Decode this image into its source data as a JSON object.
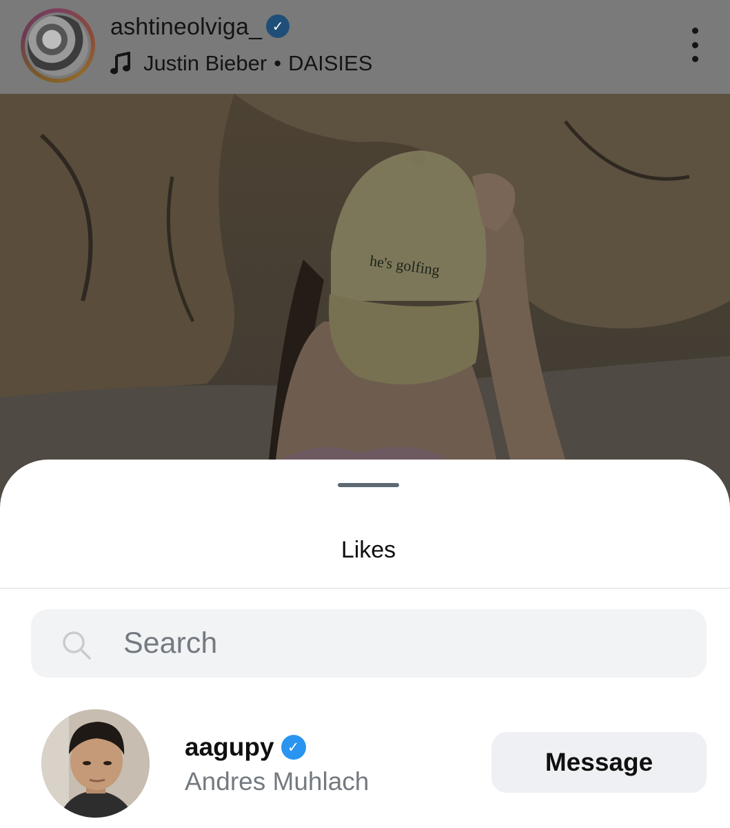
{
  "post": {
    "username": "ashtineolviga_",
    "verified": true,
    "audio_artist": "Justin Bieber",
    "audio_separator": "•",
    "audio_title": "DAISIES",
    "photo_caption_text": "he's golfing"
  },
  "likes_sheet": {
    "title": "Likes",
    "search": {
      "placeholder": "Search",
      "value": ""
    },
    "users": [
      {
        "username": "aagupy",
        "verified": true,
        "full_name": "Andres Muhlach",
        "action_label": "Message"
      }
    ]
  },
  "colors": {
    "verified_blue": "#2a95f0",
    "sheet_background": "#ffffff",
    "search_background": "#f2f3f5",
    "secondary_text": "#737a80",
    "overlay_dim": "#7a7a7a"
  },
  "icons": {
    "more": "more-options-icon",
    "music": "music-note-icon",
    "search": "search-icon",
    "verified": "verified-badge-icon"
  }
}
